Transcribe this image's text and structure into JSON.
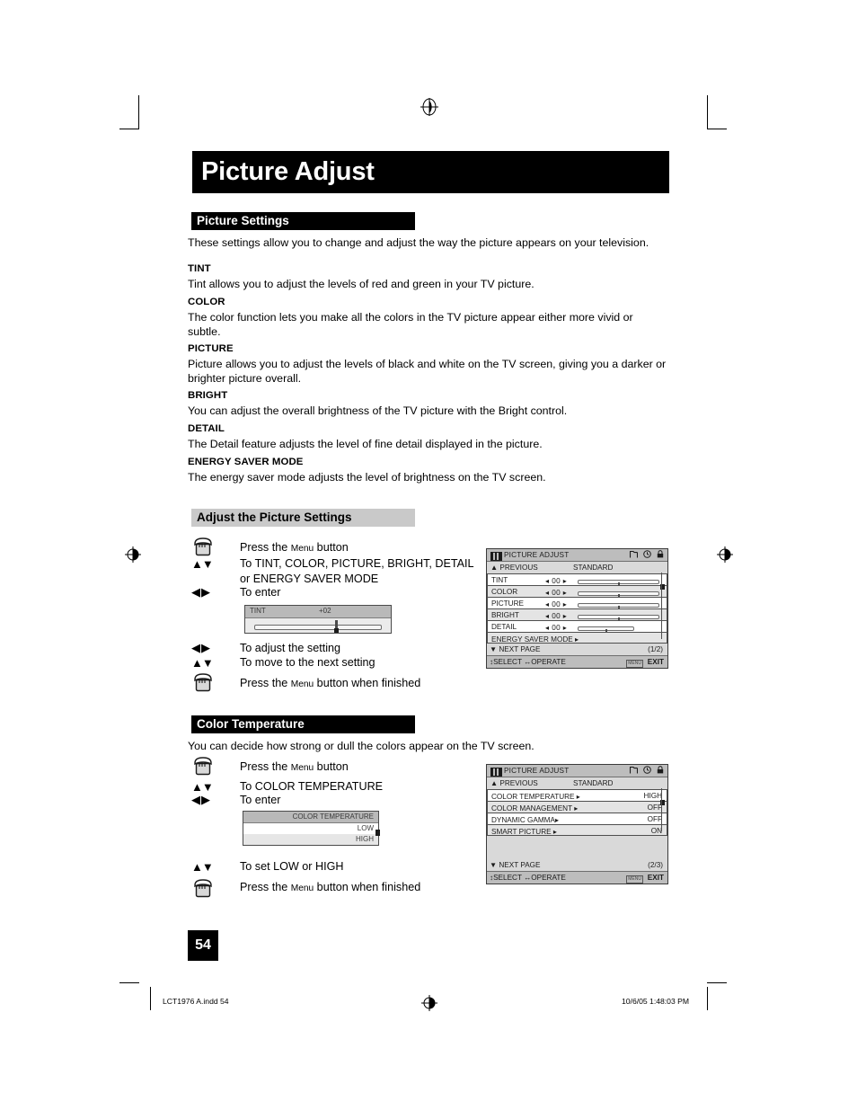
{
  "document": {
    "title": "Picture Adjust",
    "page_number": "54",
    "footer_left": "LCT1976 A.indd   54",
    "footer_right": "10/6/05   1:48:03 PM"
  },
  "sections": {
    "picture_settings": {
      "heading": "Picture Settings",
      "intro": "These settings allow you to change and adjust the way the picture appears on your television.",
      "entries": [
        {
          "term": "TINT",
          "desc": "Tint allows you to adjust the levels of red and green in your TV picture."
        },
        {
          "term": "COLOR",
          "desc": "The color function lets you make all the colors in the TV picture appear either more vivid or subtle."
        },
        {
          "term": "PICTURE",
          "desc": "Picture allows you to adjust the levels of black and white on the TV screen, giving you a darker or brighter picture overall."
        },
        {
          "term": "BRIGHT",
          "desc": "You can adjust the overall brightness of the TV picture with the Bright control."
        },
        {
          "term": "DETAIL",
          "desc": "The Detail feature adjusts the level of fine detail displayed in the picture."
        },
        {
          "term": "ENERGY SAVER MODE",
          "desc": "The energy saver mode adjusts the level of brightness on the TV screen."
        }
      ]
    },
    "adjust_picture_settings": {
      "heading": "Adjust the Picture Settings",
      "steps": [
        {
          "glyph": "hand",
          "text_pre": "Press the ",
          "small_caps": "Menu",
          "text_post": " button"
        },
        {
          "glyph": "updown",
          "text_pre": "To TINT, COLOR, PICTURE, BRIGHT, DETAIL",
          "line2": "or ENERGY SAVER MODE"
        },
        {
          "glyph": "leftright",
          "text_pre": "To enter"
        },
        {
          "glyph": "leftright",
          "text_pre": "To adjust the setting"
        },
        {
          "glyph": "updown",
          "text_pre": "To move to the next setting"
        },
        {
          "glyph": "hand",
          "text_pre": "Press the ",
          "small_caps": "Menu",
          "text_post": " button when finished"
        }
      ],
      "tint_popup": {
        "label": "TINT",
        "value": "+02"
      }
    },
    "color_temperature": {
      "heading": "Color Temperature",
      "intro": "You can decide how strong or dull the colors appear on the TV screen.",
      "steps": [
        {
          "glyph": "hand",
          "text_pre": "Press the ",
          "small_caps": "Menu",
          "text_post": " button"
        },
        {
          "glyph": "updown",
          "text_pre": "To COLOR TEMPERATURE"
        },
        {
          "glyph": "leftright",
          "text_pre": "To enter"
        },
        {
          "glyph": "updown",
          "text_pre": "To set LOW or HIGH"
        },
        {
          "glyph": "hand",
          "text_pre": "Press the ",
          "small_caps": "Menu",
          "text_post": " button when finished"
        }
      ],
      "ct_popup": {
        "header": "COLOR TEMPERATURE",
        "option_low": "LOW",
        "option_high": "HIGH"
      }
    }
  },
  "osd_screens": [
    {
      "title": "PICTURE ADJUST",
      "previous": "PREVIOUS",
      "preset": "STANDARD",
      "items": [
        {
          "name": "TINT",
          "value": "00",
          "type": "slider"
        },
        {
          "name": "COLOR",
          "value": "00",
          "type": "slider"
        },
        {
          "name": "PICTURE",
          "value": "00",
          "type": "slider"
        },
        {
          "name": "BRIGHT",
          "value": "00",
          "type": "slider"
        },
        {
          "name": "DETAIL",
          "value": "00",
          "type": "slider"
        },
        {
          "name": "ENERGY SAVER MODE",
          "value": "",
          "type": "submenu"
        }
      ],
      "next_page": "NEXT PAGE",
      "page_indicator": "(1/2)",
      "footer_select": "SELECT",
      "footer_operate": "OPERATE",
      "footer_menu": "MENU",
      "footer_exit": "EXIT"
    },
    {
      "title": "PICTURE ADJUST",
      "previous": "PREVIOUS",
      "preset": "STANDARD",
      "items": [
        {
          "name": "COLOR TEMPERATURE",
          "value": "HIGH",
          "type": "submenu"
        },
        {
          "name": "COLOR MANAGEMENT",
          "value": "OFF",
          "type": "submenu"
        },
        {
          "name": "DYNAMIC GAMMA",
          "value": "OFF",
          "type": "submenu"
        },
        {
          "name": "SMART PICTURE",
          "value": "ON",
          "type": "submenu"
        }
      ],
      "next_page": "NEXT PAGE",
      "page_indicator": "(2/3)",
      "footer_select": "SELECT",
      "footer_operate": "OPERATE",
      "footer_menu": "MENU",
      "footer_exit": "EXIT"
    }
  ]
}
